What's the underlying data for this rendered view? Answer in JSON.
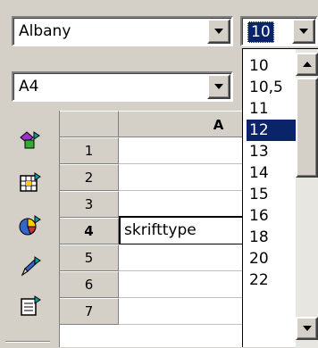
{
  "font_toolbar": {
    "font_name": "Albany",
    "font_size": "10"
  },
  "style_toolbar": {
    "page_style": "A4"
  },
  "spreadsheet": {
    "column_header": "A",
    "rows": [
      "1",
      "2",
      "3",
      "4",
      "5",
      "6",
      "7"
    ],
    "active_row": "4",
    "active_cell_text": "skrifttype"
  },
  "size_dropdown": {
    "options": [
      "10",
      "10,5",
      "11",
      "12",
      "13",
      "14",
      "15",
      "16",
      "18",
      "20",
      "22"
    ],
    "selected": "12"
  },
  "colors": {
    "selection": "#0a246a",
    "face": "#d4d0c8"
  }
}
